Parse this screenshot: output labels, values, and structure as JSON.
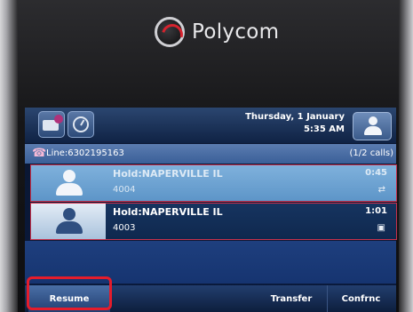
{
  "brand": {
    "name": "Polycom"
  },
  "topbar": {
    "date": "Thursday, 1 January",
    "time": "5:35 AM",
    "icons": [
      "message-icon",
      "clock-icon",
      "contact-icon"
    ]
  },
  "line": {
    "label": "Line:6302195163",
    "calls": "(1/2 calls)"
  },
  "calls": [
    {
      "status": "Hold:NAPERVILLE IL",
      "number": "4004",
      "duration": "0:45",
      "state_icon": "hold-icon"
    },
    {
      "status": "Hold:NAPERVILLE IL",
      "number": "4003",
      "duration": "1:01",
      "state_icon": "hold-icon"
    }
  ],
  "softkeys": {
    "resume": "Resume",
    "transfer": "Transfer",
    "conference": "Confrnc"
  },
  "colors": {
    "highlight": "#e51c2b",
    "row_border": "#c8314c",
    "screen_bg": "#0a1a3d"
  }
}
